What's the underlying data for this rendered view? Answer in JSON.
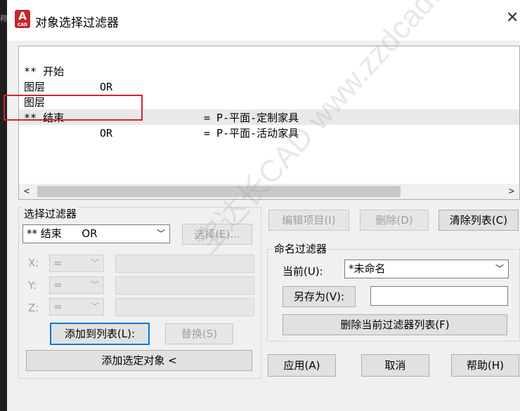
{
  "window": {
    "app_icon_letter": "A",
    "app_icon_sub": "CAD",
    "title": "对象选择过滤器",
    "close_glyph": "✕"
  },
  "bg_fragments": {
    "left_glyph": "称"
  },
  "filter_list": {
    "rows": [
      {
        "c1": "** 开始",
        "c2": "OR",
        "c3": ""
      },
      {
        "c1": "图层",
        "c2": "",
        "c3": "= P-平面-定制家具"
      },
      {
        "c1": "图层",
        "c2": "",
        "c3": "= P-平面-活动家具"
      },
      {
        "c1": "** 结束",
        "c2": "OR",
        "c3": ""
      }
    ],
    "scroll_left": "<",
    "scroll_right": ">"
  },
  "select_filter": {
    "label": "选择过滤器",
    "combo_value": "** 结束      OR",
    "select_button": "选择(E)...",
    "x_label": "X:",
    "y_label": "Y:",
    "z_label": "Z:",
    "op_value": "=",
    "add_to_list": "添加到列表(L):",
    "replace": "替换(S)",
    "add_selected": "添加选定对象 <"
  },
  "list_actions": {
    "edit_item": "编辑项目(I)",
    "delete": "删除(D)",
    "clear_list": "清除列表(C)"
  },
  "named_filters": {
    "label": "命名过滤器",
    "current_label": "当前(U):",
    "current_value": "*未命名",
    "save_as": "另存为(V):",
    "save_as_value": "",
    "delete_current": "删除当前过滤器列表(F)"
  },
  "footer": {
    "apply": "应用(A)",
    "cancel": "取消",
    "help": "帮助(H)"
  },
  "watermark": "宝达长CAD  www.zzdcad.com",
  "colors": {
    "highlight_box": "#d8232a",
    "app_icon": "#c4262e",
    "focus": "#0078d7"
  }
}
